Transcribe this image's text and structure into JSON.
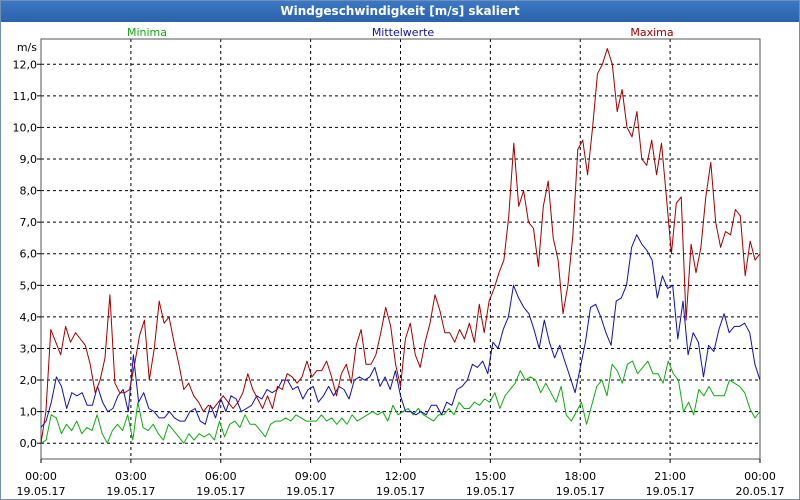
{
  "window_title": "Windgeschwindigkeit [m/s] skaliert",
  "chart_data": {
    "type": "line",
    "y_unit": "m/s",
    "ylim": [
      -0.5,
      12.8
    ],
    "yticks": [
      "0,0",
      "1,0",
      "2,0",
      "3,0",
      "4,0",
      "5,0",
      "6,0",
      "7,0",
      "8,0",
      "9,0",
      "10,0",
      "11,0",
      "12,0"
    ],
    "xlim": [
      0,
      24
    ],
    "xticks": [
      {
        "time": "00:00",
        "date": "19.05.17"
      },
      {
        "time": "03:00",
        "date": "19.05.17"
      },
      {
        "time": "06:00",
        "date": "19.05.17"
      },
      {
        "time": "09:00",
        "date": "19.05.17"
      },
      {
        "time": "12:00",
        "date": "19.05.17"
      },
      {
        "time": "15:00",
        "date": "19.05.17"
      },
      {
        "time": "18:00",
        "date": "19.05.17"
      },
      {
        "time": "21:00",
        "date": "19.05.17"
      },
      {
        "time": "00:00",
        "date": "20.05.17"
      }
    ],
    "grid": true,
    "legend_placement": "top",
    "series": [
      {
        "name": "Minima",
        "color": "#11aa11",
        "values": [
          0.0,
          0.1,
          0.9,
          0.8,
          0.3,
          0.6,
          0.4,
          0.7,
          0.3,
          0.5,
          0.4,
          0.9,
          0.3,
          0.0,
          0.4,
          0.6,
          0.4,
          0.9,
          0.1,
          1.3,
          0.5,
          0.4,
          0.6,
          0.3,
          0.1,
          0.6,
          0.4,
          0.2,
          0.0,
          0.3,
          0.1,
          0.3,
          0.2,
          0.3,
          0.1,
          0.7,
          0.2,
          0.6,
          0.7,
          0.5,
          0.9,
          0.6,
          0.6,
          0.4,
          0.2,
          0.6,
          0.7,
          0.7,
          0.8,
          0.7,
          0.9,
          0.8,
          0.7,
          0.7,
          0.7,
          0.9,
          0.7,
          0.8,
          0.6,
          0.8,
          0.6,
          0.9,
          0.7,
          0.8,
          0.9,
          1.0,
          0.9,
          1.0,
          0.7,
          1.2,
          0.9,
          1.0,
          1.1,
          0.9,
          1.1,
          0.9,
          0.8,
          0.7,
          0.9,
          0.9,
          1.1,
          0.9,
          1.3,
          1.1,
          1.1,
          1.3,
          1.2,
          1.4,
          1.3,
          1.6,
          1.1,
          1.5,
          1.7,
          1.9,
          2.3,
          2.0,
          2.1,
          2.0,
          1.6,
          1.9,
          1.6,
          1.3,
          1.8,
          0.9,
          0.7,
          1.0,
          1.3,
          0.6,
          1.2,
          1.8,
          2.0,
          1.5,
          2.5,
          2.3,
          1.9,
          2.5,
          2.6,
          2.2,
          2.4,
          2.6,
          2.2,
          2.2,
          1.9,
          2.6,
          2.2,
          2.0,
          1.0,
          1.3,
          0.9,
          1.7,
          1.5,
          1.8,
          1.5,
          1.5,
          1.5,
          2.0,
          1.9,
          1.8,
          1.6,
          1.1,
          0.8,
          1.0
        ]
      },
      {
        "name": "Mittelwerte",
        "color": "#1111aa",
        "values": [
          0.5,
          0.7,
          1.3,
          2.1,
          1.8,
          1.1,
          1.6,
          1.5,
          1.6,
          1.2,
          1.2,
          1.8,
          1.3,
          1.0,
          1.1,
          1.5,
          1.7,
          1.0,
          2.8,
          1.3,
          1.6,
          1.1,
          1.0,
          0.8,
          0.8,
          1.0,
          0.8,
          0.7,
          0.7,
          1.0,
          1.1,
          0.7,
          0.6,
          1.2,
          0.8,
          1.4,
          1.0,
          1.5,
          1.4,
          1.0,
          1.1,
          1.2,
          1.5,
          1.4,
          1.7,
          1.6,
          1.7,
          2.0,
          2.0,
          1.7,
          1.8,
          1.4,
          1.7,
          1.8,
          1.3,
          1.5,
          1.8,
          1.5,
          1.8,
          1.7,
          1.4,
          2.0,
          2.1,
          2.0,
          2.1,
          2.4,
          1.8,
          2.1,
          1.7,
          2.3,
          1.5,
          1.0,
          1.0,
          0.9,
          1.0,
          0.9,
          1.2,
          1.2,
          0.9,
          1.3,
          1.2,
          1.7,
          1.8,
          2.0,
          2.5,
          2.4,
          2.6,
          2.2,
          3.2,
          3.0,
          3.6,
          4.0,
          5.0,
          4.6,
          4.3,
          4.1,
          3.6,
          3.0,
          3.9,
          3.2,
          2.7,
          3.1,
          2.6,
          2.1,
          1.6,
          2.4,
          3.2,
          4.3,
          4.4,
          4.0,
          3.5,
          3.1,
          4.5,
          4.6,
          5.0,
          6.2,
          6.6,
          6.3,
          6.1,
          5.8,
          4.6,
          5.3,
          4.9,
          5.0,
          3.3,
          4.5,
          2.8,
          3.5,
          3.2,
          2.1,
          3.1,
          2.9,
          3.6,
          4.1,
          3.5,
          3.7,
          3.7,
          3.8,
          3.5,
          2.5,
          2.0
        ]
      },
      {
        "name": "Maxima",
        "color": "#a00000",
        "values": [
          0.0,
          1.0,
          3.6,
          3.2,
          2.8,
          3.7,
          3.2,
          3.5,
          3.3,
          3.1,
          2.5,
          1.6,
          2.0,
          2.7,
          4.7,
          1.9,
          1.6,
          1.6,
          1.7,
          2.5,
          3.4,
          3.9,
          2.0,
          3.0,
          4.5,
          3.8,
          4.0,
          3.2,
          2.5,
          1.7,
          1.9,
          1.5,
          1.3,
          1.0,
          1.2,
          1.1,
          1.3,
          1.5,
          1.3,
          1.1,
          1.3,
          1.6,
          2.2,
          1.7,
          1.4,
          1.1,
          1.5,
          1.1,
          1.8,
          1.7,
          2.2,
          2.1,
          1.9,
          2.1,
          2.6,
          2.1,
          2.3,
          2.3,
          2.6,
          2.1,
          1.5,
          2.2,
          2.5,
          1.9,
          3.1,
          3.6,
          2.5,
          2.5,
          2.8,
          3.5,
          4.3,
          3.7,
          2.5,
          1.8,
          3.3,
          3.8,
          2.8,
          2.4,
          3.2,
          3.8,
          4.7,
          4.2,
          3.5,
          3.5,
          3.2,
          3.6,
          3.3,
          3.8,
          3.2,
          4.4,
          3.5,
          4.5,
          4.9,
          5.4,
          5.8,
          7.2,
          9.5,
          7.5,
          8.0,
          7.0,
          6.8,
          5.6,
          7.5,
          8.3,
          6.5,
          5.8,
          4.1,
          5.0,
          6.6,
          9.3,
          9.6,
          8.5,
          10.0,
          11.7,
          12.0,
          12.5,
          12.0,
          10.5,
          11.2,
          10.0,
          9.7,
          10.5,
          9.0,
          8.8,
          9.6,
          8.5,
          9.5,
          7.8,
          6.0,
          7.6,
          7.8,
          3.9,
          6.3,
          5.4,
          6.2,
          7.8,
          8.9,
          7.0,
          6.2,
          6.7,
          6.6,
          7.4,
          7.2,
          5.3,
          6.4,
          5.8,
          6.0
        ]
      }
    ]
  }
}
